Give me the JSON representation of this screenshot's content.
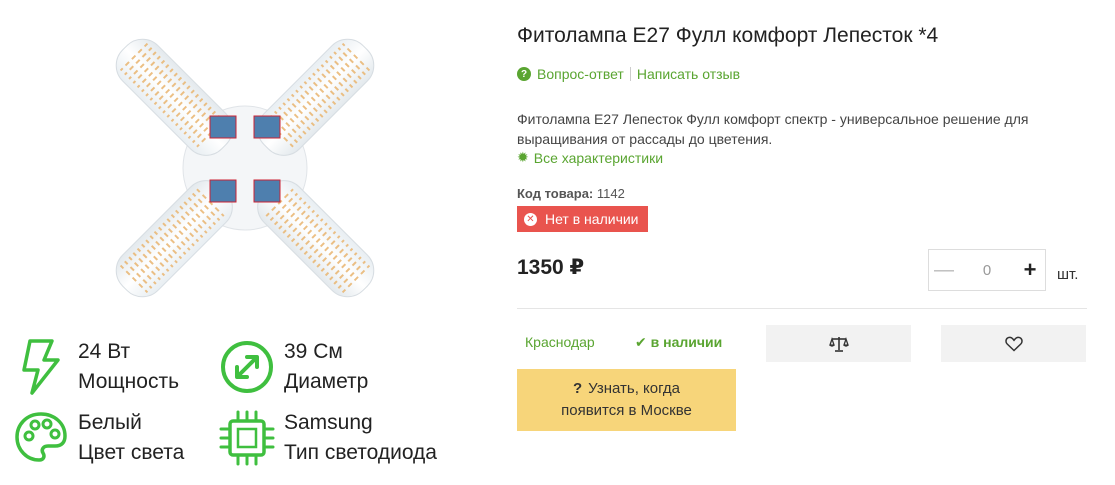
{
  "product": {
    "title": "Фитолампа E27 Фулл комфорт Лепесток *4",
    "links": {
      "qa": "Вопрос-ответ",
      "review": "Написать отзыв"
    },
    "description": "Фитолампа E27 Лепесток Фулл комфорт спектр - универсальное решение для выращивания от рассады до цветения.",
    "all_specs_link": "Все характеристики",
    "code_label": "Код товара:",
    "code_value": "1142",
    "stock_badge": "Нет в наличии",
    "price": "1350 ₽",
    "quantity": {
      "value": "0",
      "unit": "шт."
    },
    "city": "Краснодар",
    "availability": "в наличии",
    "notify_button": {
      "line1": "Узнать, когда",
      "line2": "появится в Москве"
    }
  },
  "specs": [
    {
      "value": "24 Вт",
      "label": "Мощность",
      "icon": "lightning-icon"
    },
    {
      "value": "39 См",
      "label": "Диаметр",
      "icon": "diameter-icon"
    },
    {
      "value": "Белый",
      "label": "Цвет света",
      "icon": "palette-icon"
    },
    {
      "value": "Samsung",
      "label": "Тип светодиода",
      "icon": "chip-icon"
    }
  ],
  "colors": {
    "green": "#5aa531",
    "red": "#e9544e",
    "yellow": "#f7d57a"
  }
}
